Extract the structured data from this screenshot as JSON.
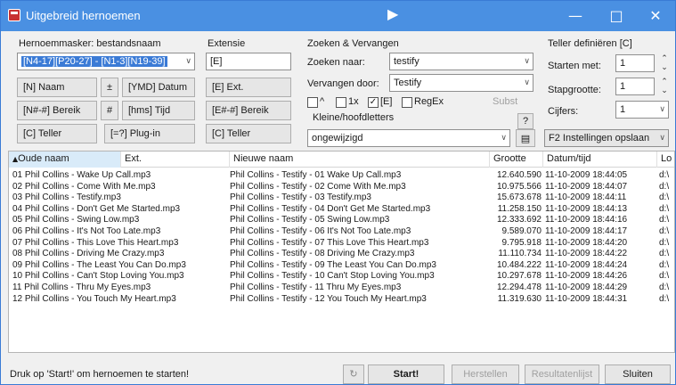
{
  "window": {
    "title": "Uitgebreid hernoemen"
  },
  "mask": {
    "label": "Hernoemmasker: bestandsnaam",
    "value": "[N4-17][P20-27] - [N1-3][N19-39]",
    "buttons": [
      "[N] Naam",
      "±",
      "[YMD] Datum",
      "[N#-#] Bereik",
      "#",
      "[hms] Tijd",
      "[C] Teller",
      "[=?] Plug-in"
    ]
  },
  "extension": {
    "label": "Extensie",
    "value": "[E]",
    "buttons": [
      "[E] Ext.",
      "[E#-#] Bereik",
      "[C] Teller"
    ]
  },
  "search": {
    "label": "Zoeken & Vervangen",
    "search_label": "Zoeken naar:",
    "search_value": "testify",
    "replace_label": "Vervangen door:",
    "replace_value": "Testify",
    "options": [
      {
        "label": "^",
        "checked": false,
        "disabled": false
      },
      {
        "label": "1x",
        "checked": false,
        "disabled": false
      },
      {
        "label": "[E]",
        "checked": true,
        "disabled": false
      },
      {
        "label": "RegEx",
        "checked": false,
        "disabled": false
      },
      {
        "label": "Subst",
        "checked": false,
        "disabled": true
      }
    ],
    "help_label": "?",
    "case_label": "Kleine/hoofdletters",
    "case_value": "ongewijzigd"
  },
  "counter": {
    "label": "Teller definiëren [C]",
    "start_label": "Starten met:",
    "start_value": "1",
    "step_label": "Stapgrootte:",
    "step_value": "1",
    "digits_label": "Cijfers:",
    "digits_value": "1",
    "save_settings": "F2 Instellingen opslaan"
  },
  "list": {
    "columns": [
      "Oude naam",
      "Ext.",
      "Nieuwe naam",
      "Grootte",
      "Datum/tijd",
      "Lo"
    ],
    "rows": [
      [
        "01 Phil Collins - Wake Up Call.mp3",
        "Phil Collins - Testify - 01 Wake Up Call.mp3",
        "12.640.590",
        "11-10-2009 18:44:05",
        "d:\\"
      ],
      [
        "02 Phil Collins - Come With Me.mp3",
        "Phil Collins - Testify - 02 Come With Me.mp3",
        "10.975.566",
        "11-10-2009 18:44:07",
        "d:\\"
      ],
      [
        "03 Phil Collins - Testify.mp3",
        "Phil Collins - Testify - 03 Testify.mp3",
        "15.673.678",
        "11-10-2009 18:44:11",
        "d:\\"
      ],
      [
        "04 Phil Collins - Don't Get Me Started.mp3",
        "Phil Collins - Testify - 04 Don't Get Me Started.mp3",
        "11.258.150",
        "11-10-2009 18:44:13",
        "d:\\"
      ],
      [
        "05 Phil Collins - Swing Low.mp3",
        "Phil Collins - Testify - 05 Swing Low.mp3",
        "12.333.692",
        "11-10-2009 18:44:16",
        "d:\\"
      ],
      [
        "06 Phil Collins - It's Not Too Late.mp3",
        "Phil Collins - Testify - 06 It's Not Too Late.mp3",
        "9.589.070",
        "11-10-2009 18:44:17",
        "d:\\"
      ],
      [
        "07 Phil Collins - This Love This Heart.mp3",
        "Phil Collins - Testify - 07 This Love This Heart.mp3",
        "9.795.918",
        "11-10-2009 18:44:20",
        "d:\\"
      ],
      [
        "08 Phil Collins - Driving Me Crazy.mp3",
        "Phil Collins - Testify - 08 Driving Me Crazy.mp3",
        "11.110.734",
        "11-10-2009 18:44:22",
        "d:\\"
      ],
      [
        "09 Phil Collins - The Least You Can Do.mp3",
        "Phil Collins - Testify - 09 The Least You Can Do.mp3",
        "10.484.222",
        "11-10-2009 18:44:24",
        "d:\\"
      ],
      [
        "10 Phil Collins - Can't Stop Loving You.mp3",
        "Phil Collins - Testify - 10 Can't Stop Loving You.mp3",
        "10.297.678",
        "11-10-2009 18:44:26",
        "d:\\"
      ],
      [
        "11 Phil Collins - Thru My Eyes.mp3",
        "Phil Collins - Testify - 11 Thru My Eyes.mp3",
        "12.294.478",
        "11-10-2009 18:44:29",
        "d:\\"
      ],
      [
        "12 Phil Collins - You Touch My Heart.mp3",
        "Phil Collins - Testify - 12 You Touch My Heart.mp3",
        "11.319.630",
        "11-10-2009 18:44:31",
        "d:\\"
      ]
    ]
  },
  "footer": {
    "status": "Druk op 'Start!' om hernoemen te starten!",
    "start": "Start!",
    "undo": "Herstellen",
    "result": "Resultatenlijst",
    "close": "Sluiten"
  },
  "colors": {
    "titlebar": "#4a90e2",
    "selection": "#3b7bd6",
    "sorted_header": "#d9ebf9"
  }
}
